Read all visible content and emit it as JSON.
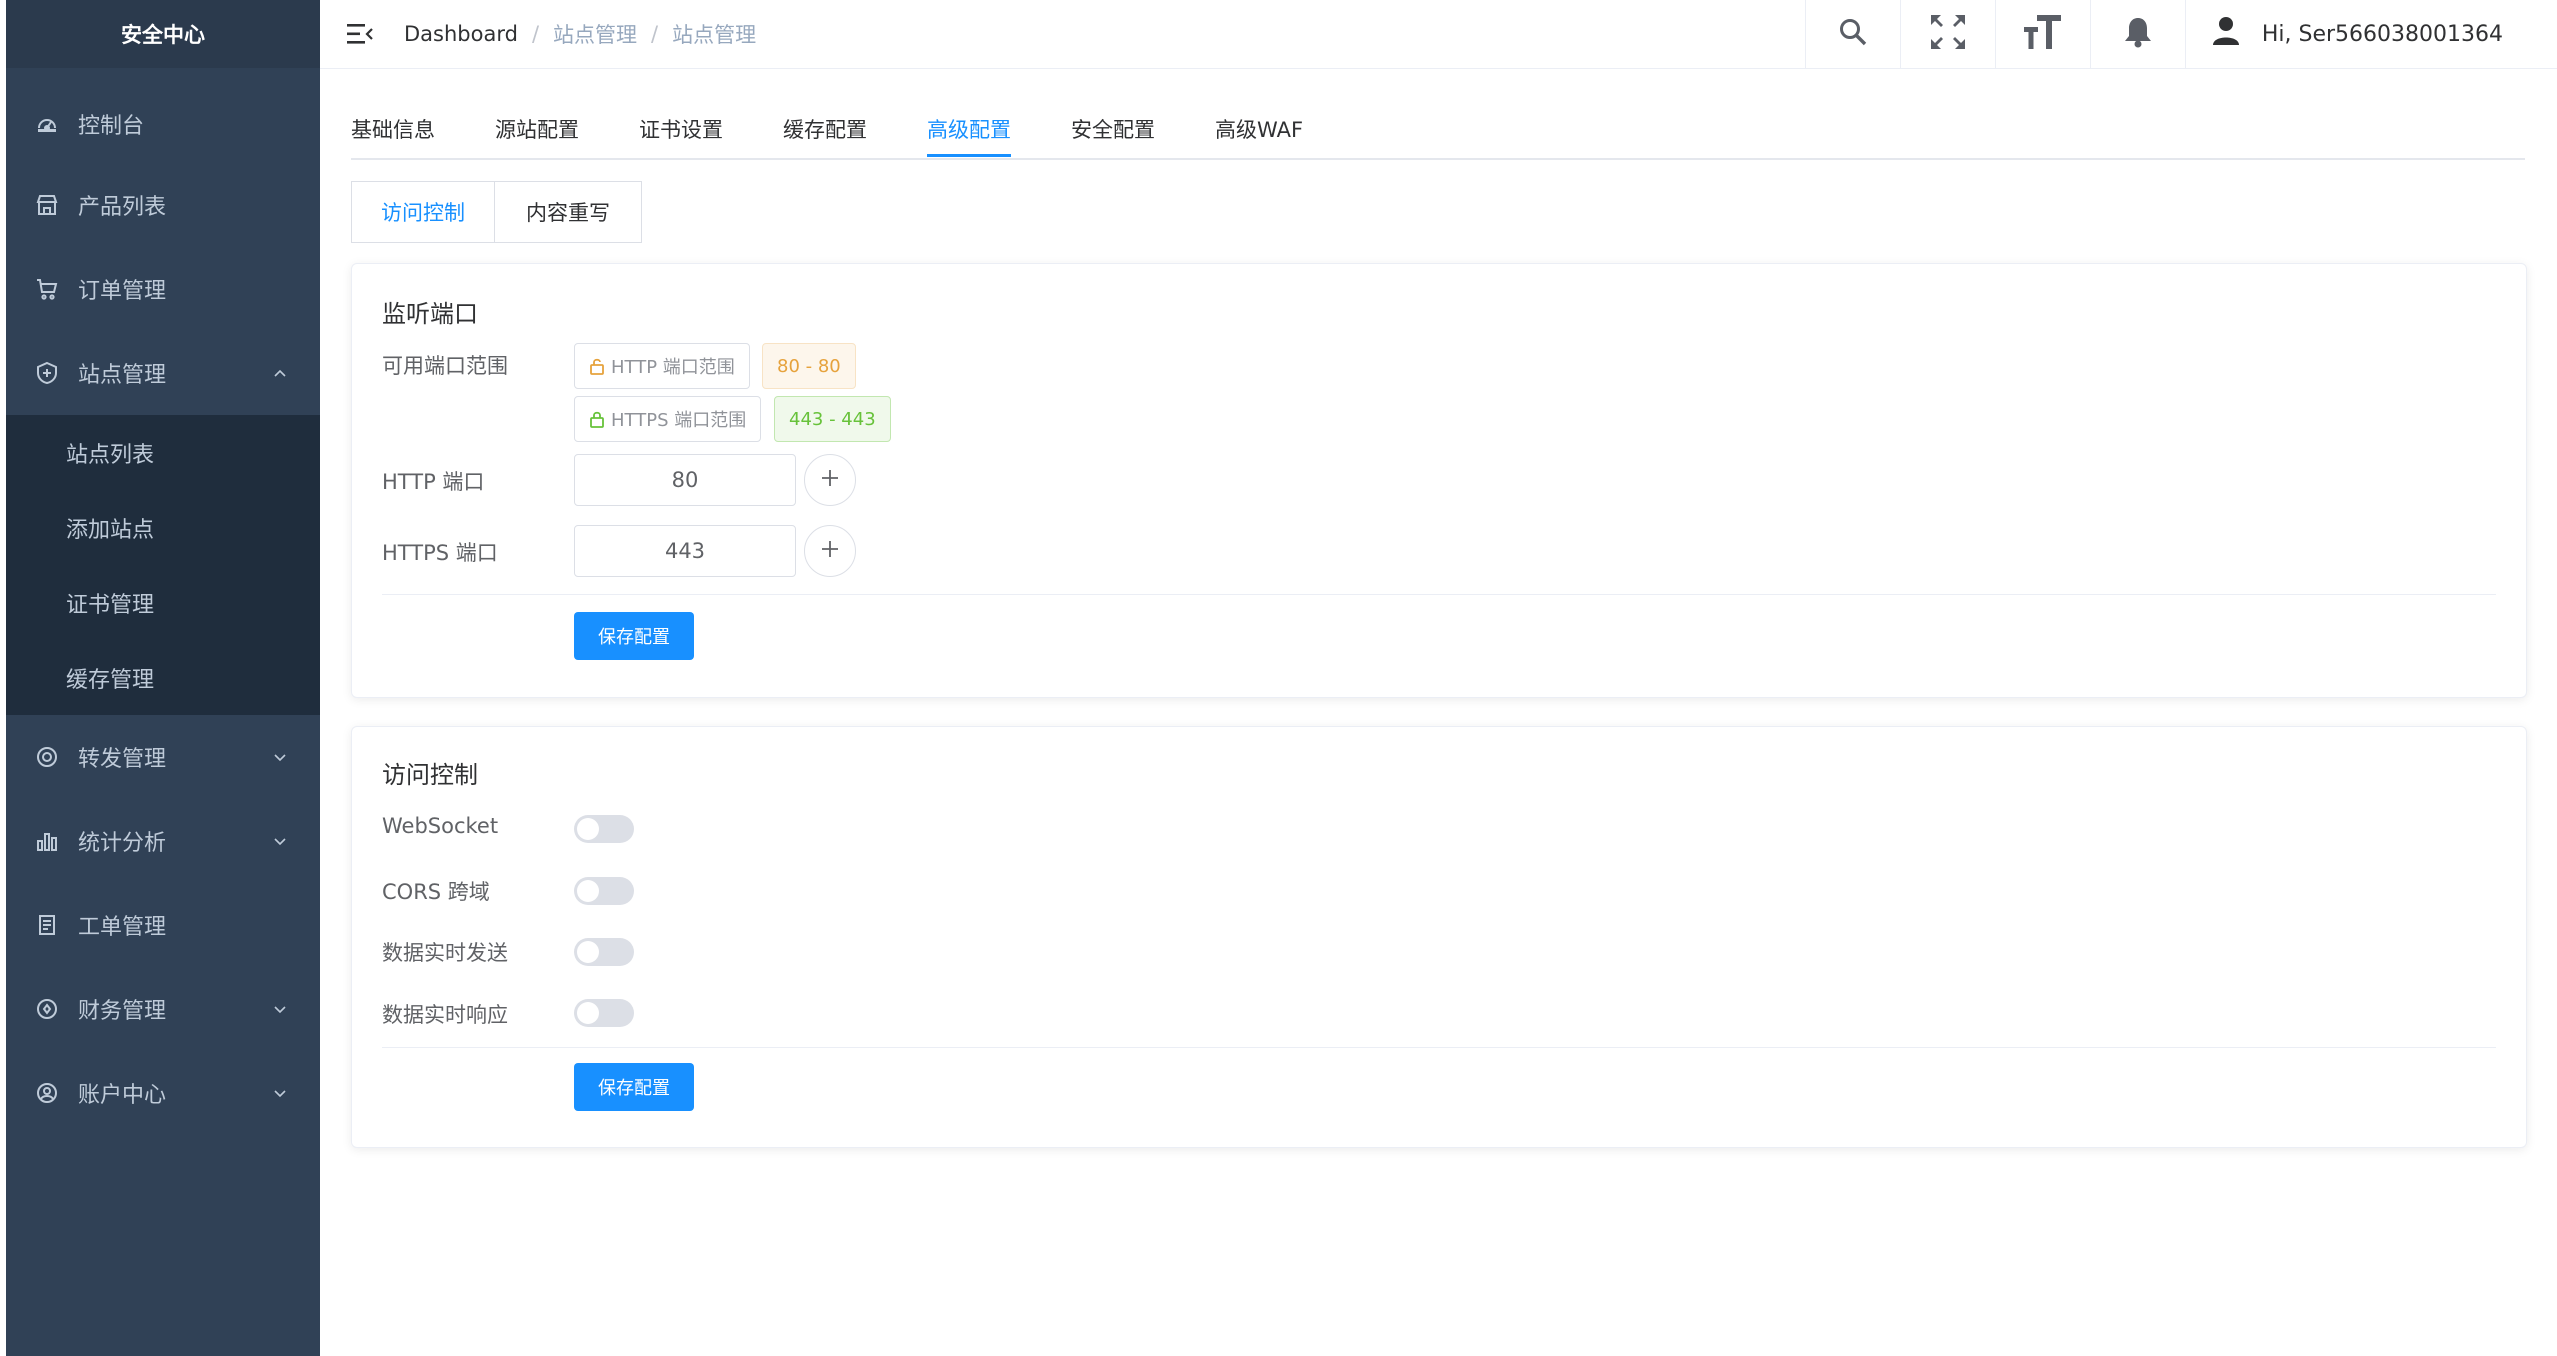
{
  "sidebar": {
    "title": "安全中心",
    "items": [
      {
        "label": "控制台",
        "icon": "dashboard-icon"
      },
      {
        "label": "产品列表",
        "icon": "store-icon"
      },
      {
        "label": "订单管理",
        "icon": "cart-icon"
      },
      {
        "label": "站点管理",
        "icon": "site-icon",
        "expanded": true,
        "children": [
          "站点列表",
          "添加站点",
          "证书管理",
          "缓存管理"
        ]
      },
      {
        "label": "转发管理",
        "icon": "forward-icon"
      },
      {
        "label": "统计分析",
        "icon": "chart-icon"
      },
      {
        "label": "工单管理",
        "icon": "ticket-icon"
      },
      {
        "label": "财务管理",
        "icon": "finance-icon"
      },
      {
        "label": "账户中心",
        "icon": "account-icon"
      }
    ]
  },
  "header": {
    "breadcrumb": [
      "Dashboard",
      "站点管理",
      "站点管理"
    ],
    "user": "Hi, Ser566038001364"
  },
  "tabs": [
    "基础信息",
    "源站配置",
    "证书设置",
    "缓存配置",
    "高级配置",
    "安全配置",
    "高级WAF"
  ],
  "active_tab": "高级配置",
  "subtabs": [
    "访问控制",
    "内容重写"
  ],
  "listen_ports": {
    "title": "监听端口",
    "range_label": "可用端口范围",
    "http_range_tag": "HTTP 端口范围",
    "http_range_value": "80 - 80",
    "https_range_tag": "HTTPS 端口范围",
    "https_range_value": "443 - 443",
    "http_label": "HTTP 端口",
    "http_value": "80",
    "https_label": "HTTPS 端口",
    "https_value": "443",
    "save": "保存配置"
  },
  "access_control": {
    "title": "访问控制",
    "websocket": "WebSocket",
    "cors": "CORS 跨域",
    "realtime_send": "数据实时发送",
    "realtime_response": "数据实时响应",
    "save": "保存配置"
  },
  "colors": {
    "sidebar": "#304156",
    "accent": "#1890ff",
    "warning": "#e6a23c",
    "success": "#67c23a"
  }
}
